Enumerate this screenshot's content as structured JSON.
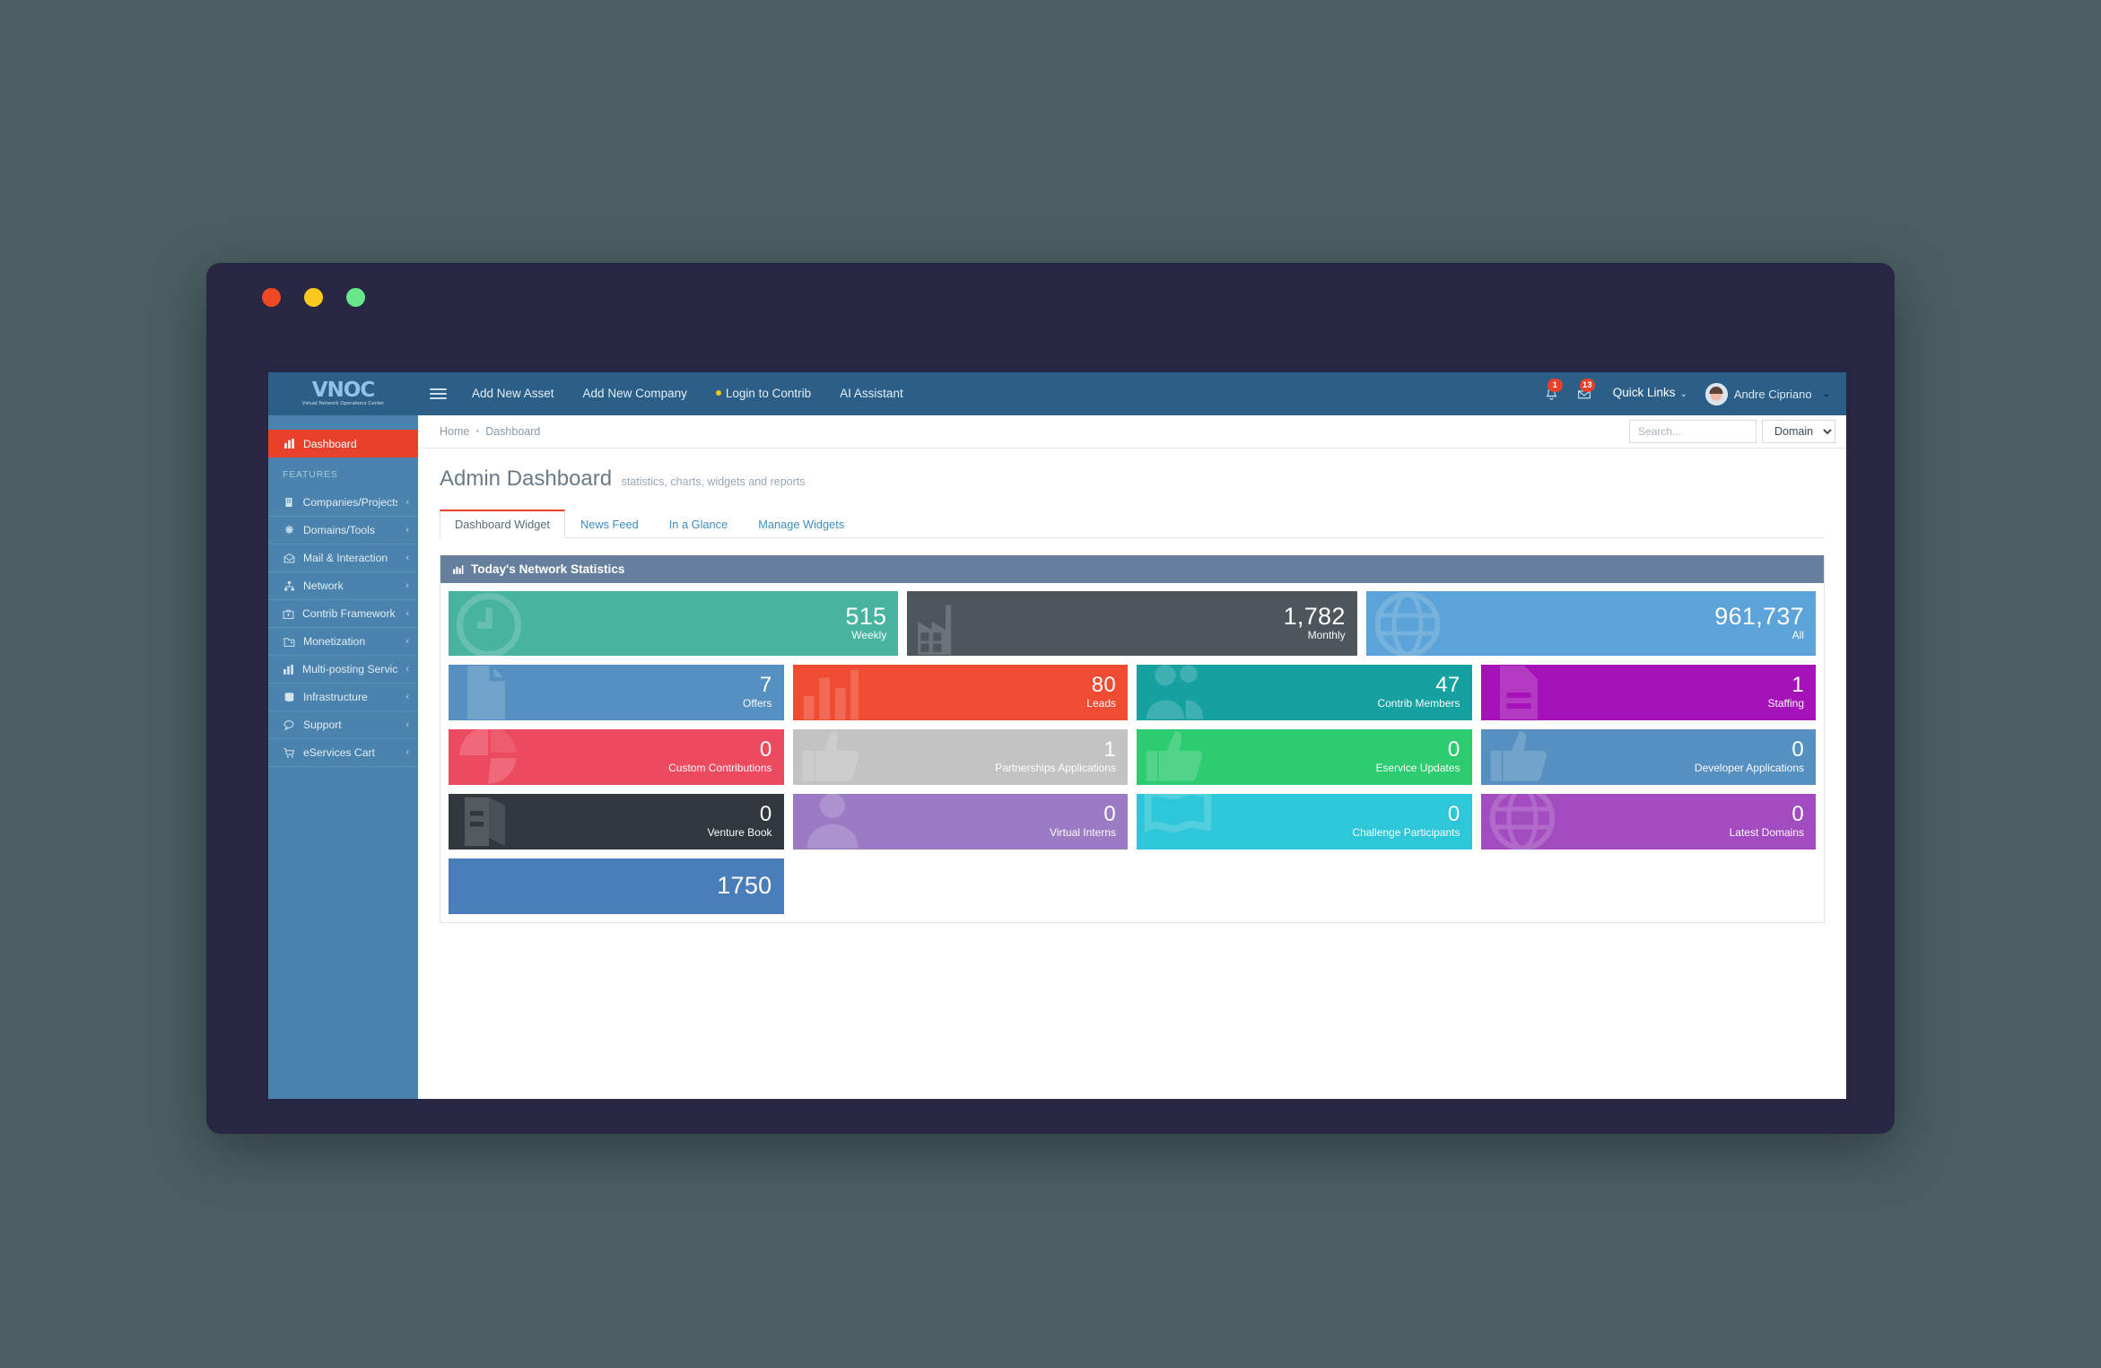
{
  "window": {
    "dots": [
      "close",
      "minimize",
      "maximize"
    ]
  },
  "brand": {
    "logo_text": "VNOC",
    "logo_subtitle": "Virtual Network Operations Center"
  },
  "topnav": {
    "items": [
      {
        "label": "Add New Asset",
        "dot": false
      },
      {
        "label": "Add New Company",
        "dot": false
      },
      {
        "label": "Login to Contrib",
        "dot": true
      },
      {
        "label": "AI Assistant",
        "dot": false
      }
    ],
    "alerts_badge": "1",
    "messages_badge": "13",
    "quick_links_label": "Quick Links",
    "user_name": "Andre Cipriano"
  },
  "breadcrumb": {
    "home": "Home",
    "separator": "•",
    "current": "Dashboard"
  },
  "search": {
    "placeholder": "Search...",
    "value": "",
    "scope_selected": "Domain",
    "scope_options": [
      "Domain"
    ]
  },
  "page": {
    "title": "Admin Dashboard",
    "subtitle": "statistics, charts, widgets and reports"
  },
  "tabs": [
    {
      "label": "Dashboard Widget",
      "active": true
    },
    {
      "label": "News Feed",
      "active": false
    },
    {
      "label": "In a Glance",
      "active": false
    },
    {
      "label": "Manage Widgets",
      "active": false
    }
  ],
  "sidebar": {
    "active_item": {
      "label": "Dashboard",
      "icon": "bar-chart-icon"
    },
    "section_heading": "FEATURES",
    "items": [
      {
        "label": "Companies/Projects",
        "icon": "building-icon",
        "arrow": "‹"
      },
      {
        "label": "Domains/Tools",
        "icon": "gear-icon",
        "arrow": "‹"
      },
      {
        "label": "Mail & Interaction",
        "icon": "envelope-icon",
        "arrow": "‹"
      },
      {
        "label": "Network",
        "icon": "sitemap-icon",
        "arrow": "‹"
      },
      {
        "label": "Contrib Framework Apps",
        "icon": "briefcase-icon",
        "arrow": "‹"
      },
      {
        "label": "Monetization",
        "icon": "folder-icon",
        "arrow": "‹"
      },
      {
        "label": "Multi-posting Services",
        "icon": "bar-chart-icon",
        "arrow": "‹"
      },
      {
        "label": "Infrastructure",
        "icon": "database-icon",
        "arrow": "‹"
      },
      {
        "label": "Support",
        "icon": "comments-icon",
        "arrow": "‹"
      },
      {
        "label": "eServices Cart",
        "icon": "cart-icon",
        "arrow": "‹"
      }
    ]
  },
  "panel": {
    "title": "Today's Network Statistics",
    "icon": "chart-icon",
    "header_color": "#667f9c"
  },
  "chart_data": {
    "type": "table",
    "title": "Today's Network Statistics",
    "rows": [
      [
        {
          "value": "515",
          "label": "Weekly",
          "color": "#48b4a0",
          "watermark": "clock-icon"
        },
        {
          "value": "1,782",
          "label": "Monthly",
          "color": "#4e555b",
          "watermark": "factory-icon"
        },
        {
          "value": "961,737",
          "label": "All",
          "color": "#5ba3d9",
          "watermark": "globe-icon"
        }
      ],
      [
        {
          "value": "7",
          "label": "Offers",
          "color": "#5590c0",
          "watermark": "file-icon"
        },
        {
          "value": "80",
          "label": "Leads",
          "color": "#ef4c33",
          "watermark": "bars-icon"
        },
        {
          "value": "47",
          "label": "Contrib Members",
          "color": "#16a0a0",
          "watermark": "users-icon"
        },
        {
          "value": "1",
          "label": "Staffing",
          "color": "#a512b8",
          "watermark": "document-icon"
        }
      ],
      [
        {
          "value": "0",
          "label": "Custom Contributions",
          "color": "#ec4b5f",
          "watermark": "pie-icon"
        },
        {
          "value": "1",
          "label": "Partnerships Applications",
          "color": "#c3c3c3",
          "watermark": "thumb-icon"
        },
        {
          "value": "0",
          "label": "Eservice Updates",
          "color": "#2ecc71",
          "watermark": "thumb-icon"
        },
        {
          "value": "0",
          "label": "Developer Applications",
          "color": "#5590c0",
          "watermark": "thumb-icon"
        }
      ],
      [
        {
          "value": "0",
          "label": "Venture Book",
          "color": "#32383e",
          "watermark": "book-icon"
        },
        {
          "value": "0",
          "label": "Virtual Interns",
          "color": "#9b7cc4",
          "watermark": "user-icon"
        },
        {
          "value": "0",
          "label": "Challenge Participants",
          "color": "#2ec6d9",
          "watermark": "flag-icon"
        },
        {
          "value": "0",
          "label": "Latest Domains",
          "color": "#a34cc0",
          "watermark": "globe-icon"
        }
      ]
    ],
    "partial_row": [
      {
        "value": "1750",
        "label": "",
        "color": "#4a7ebb",
        "watermark": ""
      }
    ]
  },
  "colors": {
    "topbar": "#2b5f88",
    "sidebar": "#4a83ad",
    "accent_red": "#e8412b",
    "panel_header": "#667f9c",
    "desktop": "#4a5f63",
    "window_frame": "#272744"
  }
}
